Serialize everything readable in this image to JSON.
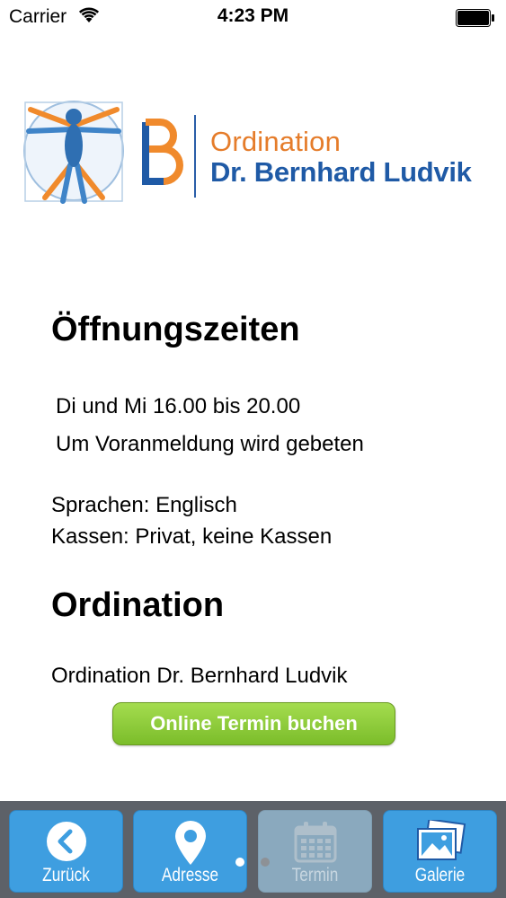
{
  "status_bar": {
    "carrier": "Carrier",
    "time": "4:23 PM"
  },
  "logo": {
    "line1": "Ordination",
    "line2": "Dr. Bernhard Ludvik"
  },
  "hours": {
    "heading": "Öffnungszeiten",
    "line1": "Di und Mi  16.00 bis 20.00",
    "line2": "Um Voranmeldung wird gebeten",
    "languages": "Sprachen: Englisch",
    "insurance": "Kassen: Privat, keine Kassen"
  },
  "ordination": {
    "heading": "Ordination",
    "name": "Ordination Dr. Bernhard Ludvik",
    "cta_label": "Online Termin buchen"
  },
  "tabbar": {
    "tabs": [
      {
        "label": "Zurück",
        "icon": "back-chevron-icon"
      },
      {
        "label": "Adresse",
        "icon": "location-pin-icon"
      },
      {
        "label": "Termin",
        "icon": "calendar-icon",
        "state": "disabled"
      },
      {
        "label": "Galerie",
        "icon": "photo-gallery-icon"
      }
    ]
  },
  "colors": {
    "accent_blue": "#3e9ee0",
    "cta_green": "#86c436",
    "logo_orange": "#e57c2a",
    "logo_blue": "#1f5aa6"
  }
}
